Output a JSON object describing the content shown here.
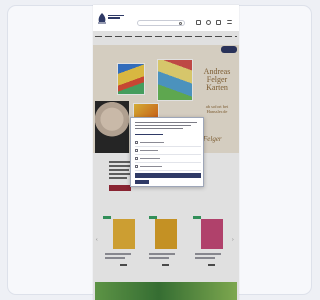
{
  "header": {
    "brand": "",
    "search_placeholder": "",
    "icons": [
      "search-icon",
      "user-icon",
      "heart-icon",
      "cart-icon"
    ]
  },
  "nav": {
    "items": [
      "",
      "",
      "",
      "",
      "",
      "",
      "",
      "",
      "",
      "",
      "",
      ""
    ]
  },
  "hero": {
    "title": "Andreas Felger Karten",
    "subtitle": "ab sofort bei Hanssler.de",
    "signature": "Felger"
  },
  "cookie_dialog": {
    "title": "",
    "options": [
      "",
      "",
      "",
      ""
    ],
    "accept_label": "",
    "save_label": ""
  },
  "products": [
    {
      "color": "#e9b43a"
    },
    {
      "color": "#e0a62a"
    },
    {
      "color": "#c94b7a"
    }
  ],
  "promo": {
    "text": ""
  },
  "colors": {
    "brand": "#2f3a66",
    "hero_bg": "#f2eadb",
    "accent_red": "#9c2a3a",
    "tag_green": "#3aa366"
  }
}
